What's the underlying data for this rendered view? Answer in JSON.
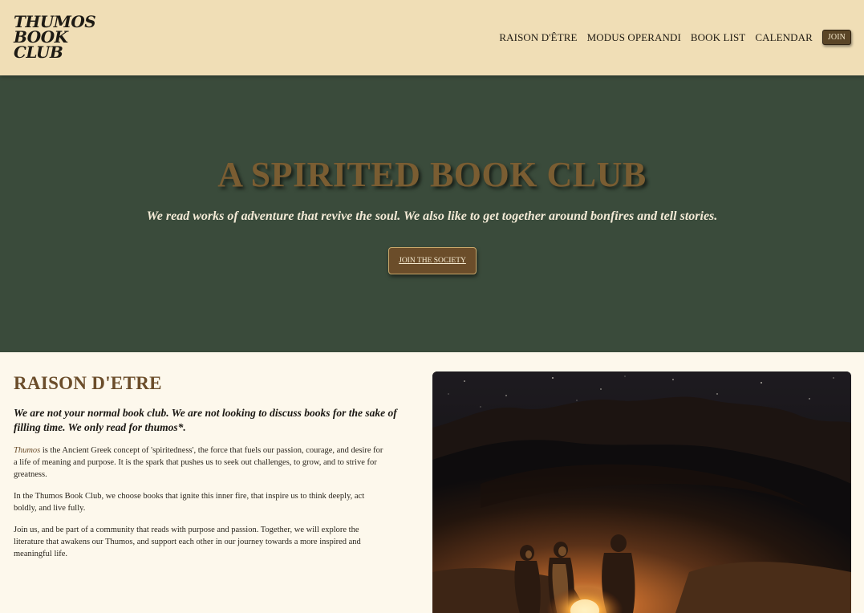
{
  "header": {
    "logo_lines": [
      "THUMOS",
      "BOOK",
      "CLUB"
    ],
    "nav": [
      "RAISON D'ÊTRE",
      "MODUS OPERANDI",
      "BOOK LIST",
      "CALENDAR"
    ],
    "join_label": "JOIN"
  },
  "hero": {
    "title": "A SPIRITED BOOK CLUB",
    "subtitle": "We read works of adventure that revive the soul. We also like to get together around bonfires and tell stories.",
    "cta_label": "JOIN THE SOCIETY"
  },
  "about": {
    "title": "RAISON D'ETRE",
    "lead": "We are not your normal book club. We are not looking to discuss books for the sake of filling time. We only read for thumos*.",
    "p1_word": "Thumos",
    "p1_rest": " is the Ancient Greek concept of 'spiritedness', the force that fuels our passion, courage, and desire for a life of meaning and purpose. It is the spark that pushes us to seek out challenges, to grow, and to strive for greatness.",
    "p2": "In the Thumos Book Club, we choose books that ignite this inner fire, that inspire us to think deeply, act boldly, and live fully.",
    "p3": "Join us, and be part of a community that reads with purpose and passion. Together, we will explore the literature that awakens our Thumos, and support each other in our journey towards a more inspired and meaningful life."
  },
  "colors": {
    "header_bg": "#f0deb6",
    "hero_bg": "#3a4b3b",
    "accent_brown": "#6b4d2a",
    "page_bg": "#fdf8ec"
  },
  "icons": {
    "photo": "campfire-photo"
  }
}
